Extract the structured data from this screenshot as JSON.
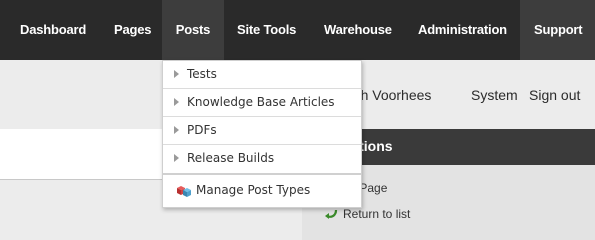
{
  "nav": {
    "items": [
      "Dashboard",
      "Pages",
      "Posts",
      "Site Tools",
      "Warehouse",
      "Administration",
      "Support"
    ],
    "active": "Posts"
  },
  "user_bar": {
    "user_name": "seph Voorhees",
    "system": "System",
    "sign_out": "Sign out"
  },
  "options": {
    "title": "options",
    "add_label": "d new Page",
    "return_label": "Return to list"
  },
  "dropdown": {
    "items": [
      "Tests",
      "Knowledge Base Articles",
      "PDFs",
      "Release Builds"
    ],
    "manage_label": "Manage Post Types",
    "manage_icon": "cube-stack-icon"
  },
  "colors": {
    "nav_bg": "#2a2a2a",
    "nav_active_bg": "#3d3d3d",
    "panel_header_bg": "#3a3a3a",
    "page_bg": "#ececec"
  }
}
